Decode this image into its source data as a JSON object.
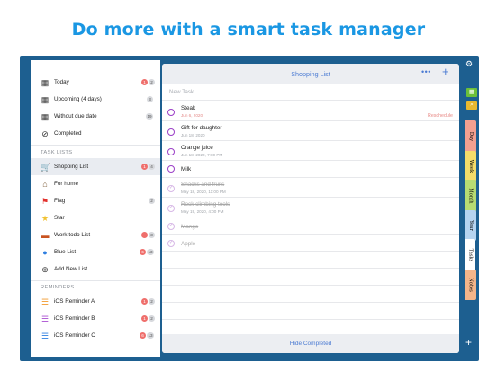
{
  "headline": "Do more with a smart task manager",
  "sidebar": {
    "smart_lists": [
      {
        "label": "Today",
        "icon": "calendar-icon",
        "badge_red": "1",
        "badge_gray": "2"
      },
      {
        "label": "Upcoming (4 days)",
        "icon": "calendar-upcoming-icon",
        "badge_gray": "3"
      },
      {
        "label": "Without due date",
        "icon": "calendar-nodate-icon",
        "badge_gray": "19"
      },
      {
        "label": "Completed",
        "icon": "check-circle-icon"
      }
    ],
    "task_lists_header": "TASK LISTS",
    "task_lists": [
      {
        "label": "Shopping List",
        "icon": "cart-icon",
        "badge_red": "1",
        "badge_gray": "4"
      },
      {
        "label": "For home",
        "icon": "house-icon"
      },
      {
        "label": "Flag",
        "icon": "flag-icon",
        "badge_gray": "2"
      },
      {
        "label": "Star",
        "icon": "star-icon"
      },
      {
        "label": "Work todo List",
        "icon": "briefcase-icon",
        "badge_gray": "3"
      },
      {
        "label": "Blue List",
        "icon": "blue-dot-icon",
        "badge_red": "6",
        "badge_gray": "13"
      },
      {
        "label": "Add New List",
        "icon": "plus-circle-icon"
      }
    ],
    "reminders_header": "REMINDERS",
    "reminders": [
      {
        "label": "iOS Reminder A",
        "icon": "list-orange-icon",
        "badge_red": "1",
        "badge_gray": "2"
      },
      {
        "label": "iOS Reminder B",
        "icon": "list-purple-icon",
        "badge_red": "1",
        "badge_gray": "2"
      },
      {
        "label": "iOS Reminder C",
        "icon": "list-blue-icon",
        "badge_red": "6",
        "badge_gray": "13"
      }
    ]
  },
  "main": {
    "title": "Shopping List",
    "more_label": "•••",
    "add_label": "+",
    "new_task_placeholder": "New Task",
    "tasks": [
      {
        "title": "Steak",
        "date": "Jun 6, 2020",
        "action": "Reschedule",
        "done": false
      },
      {
        "title": "Gift for daughter",
        "date": "Jun 18, 2020",
        "done": false
      },
      {
        "title": "Orange juice",
        "date": "Jun 18, 2020, 7:00 PM",
        "done": false
      },
      {
        "title": "Milk",
        "date": "",
        "done": false
      },
      {
        "title": "Snacks and fruits",
        "date": "May 18, 2020, 11:00 PM",
        "done": true
      },
      {
        "title": "Rock climbing tools",
        "date": "May 19, 2020, 4:00 PM",
        "done": true
      },
      {
        "title": "Mango",
        "date": "",
        "done": true
      },
      {
        "title": "Apple",
        "date": "",
        "done": true
      }
    ],
    "footer_label": "Hide Completed"
  },
  "right_rail": {
    "gear": "⚙",
    "add": "+",
    "tabs": [
      "Day",
      "Week",
      "Month",
      "Year",
      "Tasks",
      "Notes"
    ]
  },
  "colors": {
    "accent": "#4b7bd3",
    "headline": "#1a97e3",
    "frame": "#1d5f90",
    "task_circle": "#9b3fc7",
    "badge_red": "#ef6f6c"
  }
}
